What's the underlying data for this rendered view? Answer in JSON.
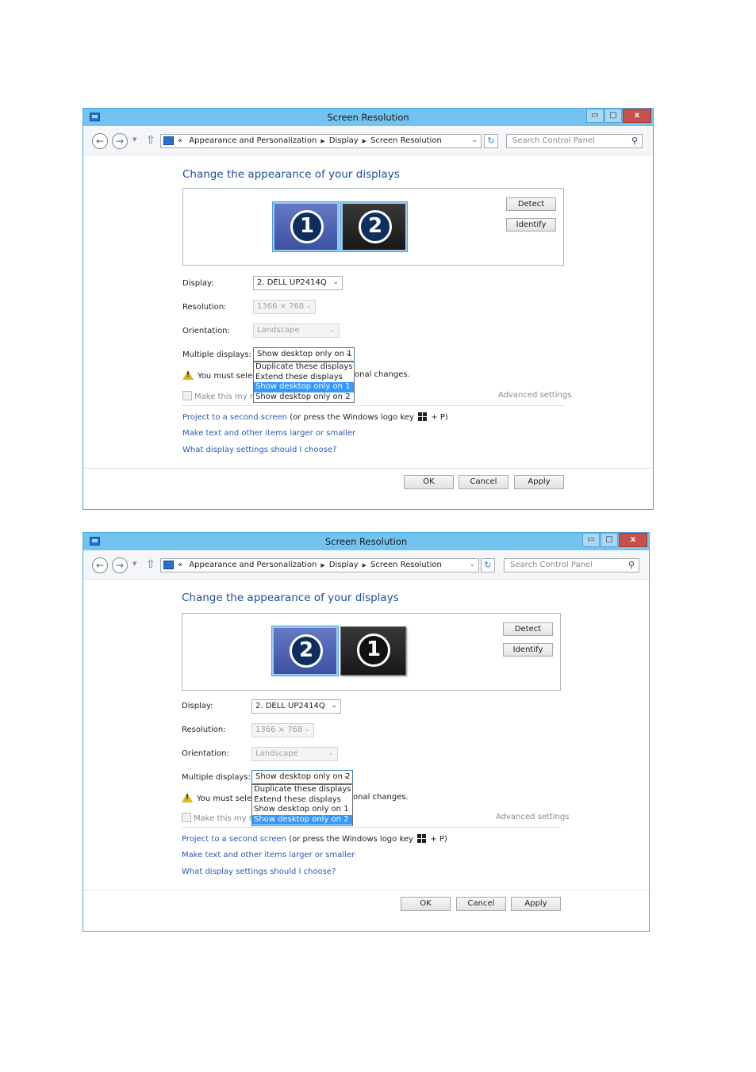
{
  "windows": [
    {
      "title": "Screen Resolution",
      "window_buttons": {
        "minimize": "▭",
        "maximize": "□",
        "close": "x"
      },
      "address": {
        "prefix": "«",
        "crumbs": [
          "Appearance and Personalization",
          "Display",
          "Screen Resolution"
        ],
        "search_placeholder": "Search Control Panel"
      },
      "heading": "Change the appearance of your displays",
      "monitors": [
        {
          "number": "1",
          "selected": true
        },
        {
          "number": "2",
          "selected": true
        }
      ],
      "detect_label": "Detect",
      "identify_label": "Identify",
      "display_label": "Display:",
      "display_value": "2. DELL UP2414Q",
      "resolution_label": "Resolution:",
      "resolution_value": "1366 × 768",
      "orientation_label": "Orientation:",
      "orientation_value": "Landscape",
      "multiple_label": "Multiple displays:",
      "multiple_value": "Show desktop only on 1",
      "multiple_options": [
        "Duplicate these displays",
        "Extend these displays",
        "Show desktop only on 1",
        "Show desktop only on 2"
      ],
      "multiple_highlighted": 2,
      "warning_text": "You must select",
      "warning_tail": "onal changes.",
      "checkbox_text": "Make this my ma",
      "advanced_settings": "Advanced settings",
      "project_link": "Project to a second screen",
      "project_hint_pre": "(or press the Windows logo key",
      "project_hint_post": "+ P)",
      "text_size_link": "Make text and other items larger or smaller",
      "what_settings_link": "What display settings should I choose?",
      "ok_label": "OK",
      "cancel_label": "Cancel",
      "apply_label": "Apply"
    },
    {
      "title": "Screen Resolution",
      "window_buttons": {
        "minimize": "▭",
        "maximize": "□",
        "close": "x"
      },
      "address": {
        "prefix": "«",
        "crumbs": [
          "Appearance and Personalization",
          "Display",
          "Screen Resolution"
        ],
        "search_placeholder": "Search Control Panel"
      },
      "heading": "Change the appearance of your displays",
      "monitors": [
        {
          "number": "2",
          "selected": true
        },
        {
          "number": "1",
          "selected": false
        }
      ],
      "detect_label": "Detect",
      "identify_label": "Identify",
      "display_label": "Display:",
      "display_value": "2. DELL UP2414Q",
      "resolution_label": "Resolution:",
      "resolution_value": "1366 × 768",
      "orientation_label": "Orientation:",
      "orientation_value": "Landscape",
      "multiple_label": "Multiple displays:",
      "multiple_value": "Show desktop only on 2",
      "multiple_options": [
        "Duplicate these displays",
        "Extend these displays",
        "Show desktop only on 1",
        "Show desktop only on 2"
      ],
      "multiple_highlighted": 3,
      "warning_text": "You must select",
      "warning_tail": "onal changes.",
      "checkbox_text": "Make this my ma",
      "advanced_settings": "Advanced settings",
      "project_link": "Project to a second screen",
      "project_hint_pre": "(or press the Windows logo key",
      "project_hint_post": "+ P)",
      "text_size_link": "Make text and other items larger or smaller",
      "what_settings_link": "What display settings should I choose?",
      "ok_label": "OK",
      "cancel_label": "Cancel",
      "apply_label": "Apply"
    }
  ]
}
